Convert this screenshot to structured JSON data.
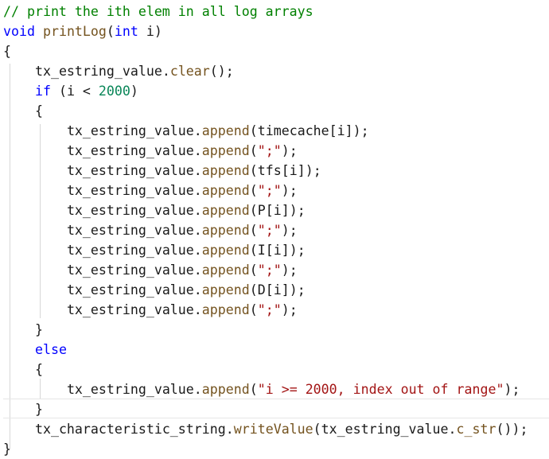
{
  "code": {
    "lines": [
      "// print the ith elem in all log arrays",
      "void printLog(int i)",
      "{",
      "    tx_estring_value.clear();",
      "    if (i < 2000)",
      "    {",
      "        tx_estring_value.append(timecache[i]);",
      "        tx_estring_value.append(\";\");",
      "        tx_estring_value.append(tfs[i]);",
      "        tx_estring_value.append(\";\");",
      "        tx_estring_value.append(P[i]);",
      "        tx_estring_value.append(\";\");",
      "        tx_estring_value.append(I[i]);",
      "        tx_estring_value.append(\";\");",
      "        tx_estring_value.append(D[i]);",
      "        tx_estring_value.append(\";\");",
      "    }",
      "    else",
      "    {",
      "        tx_estring_value.append(\"i >= 2000, index out of range\");",
      "    }",
      "    tx_characteristic_string.writeValue(tx_estring_value.c_str());",
      "}"
    ],
    "colors": {
      "comment": "#008000",
      "keyword": "#0000ff",
      "number": "#098658",
      "string": "#a31515",
      "function": "#74531f",
      "identifier": "#1f377f",
      "plain": "#1a1a1a"
    },
    "highlighted_line": 21
  }
}
